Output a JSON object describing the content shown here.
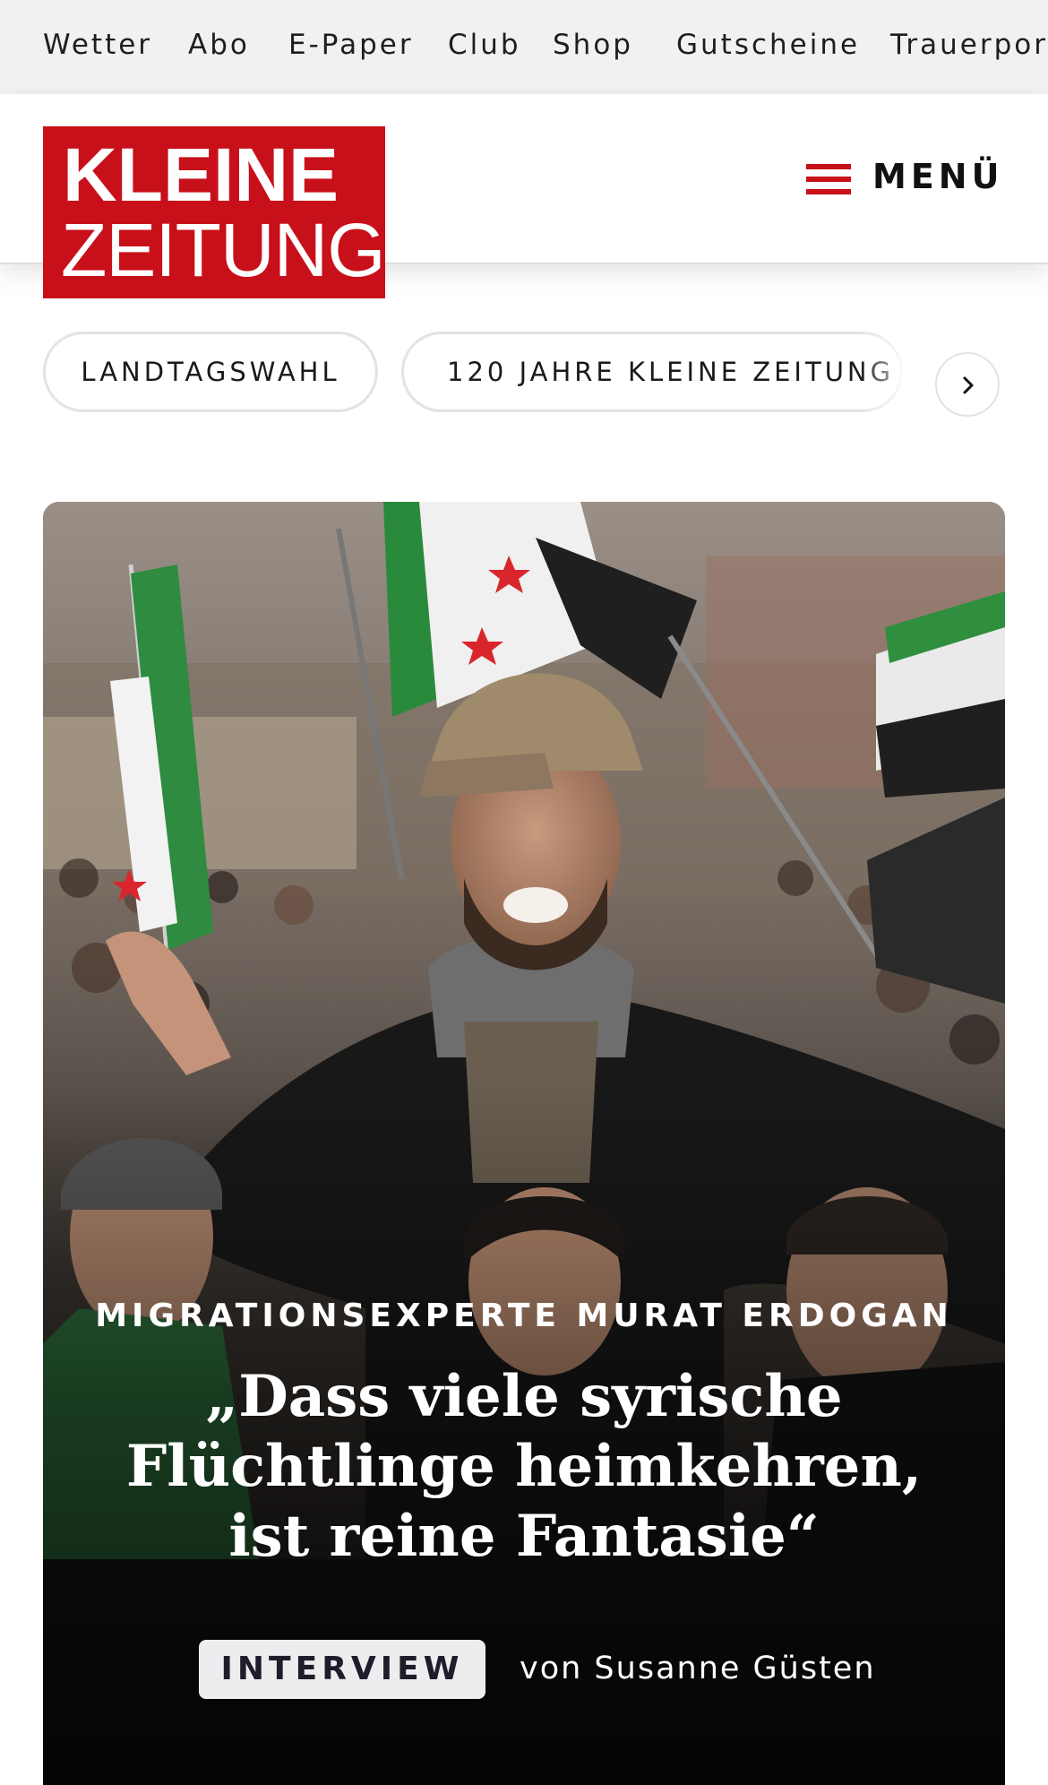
{
  "topbar": {
    "items": [
      "Wetter",
      "Abo",
      "E-Paper",
      "Club",
      "Shop",
      "Gutscheine",
      "Trauerportal"
    ]
  },
  "header": {
    "logo_line1": "KLEINE",
    "logo_line2": "ZEITUNG",
    "menu_label": "MENÜ",
    "brand_color": "#c8101a"
  },
  "chips": {
    "items": [
      "LANDTAGSWAHL",
      "120 JAHRE KLEINE ZEITUNG"
    ],
    "next_icon": "chevron-right-icon"
  },
  "hero": {
    "kicker": "MIGRATIONSEXPERTE MURAT ERDOGAN",
    "headline": "„Dass viele syrische Flüchtlinge heimkehren, ist reine Fantasie“",
    "badge": "INTERVIEW",
    "byline": "von Susanne Güsten"
  }
}
